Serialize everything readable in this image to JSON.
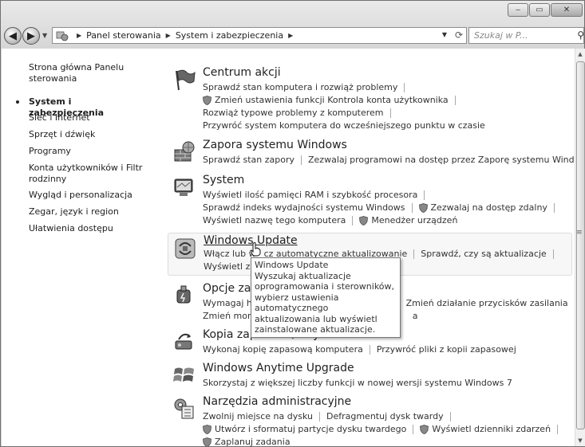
{
  "window": {
    "minimize": "‒",
    "maximize": "▭",
    "close": "✕"
  },
  "nav": {
    "back": "◀",
    "forward": "▶",
    "dropdown": "▼"
  },
  "address": {
    "crumbs": [
      "Panel sterowania",
      "System i zabezpieczenia"
    ],
    "separator": "▶",
    "dropdown": "▼",
    "refresh": "⟳"
  },
  "search": {
    "placeholder": "Szukaj w P...",
    "icon": "search-icon"
  },
  "sidebar": {
    "items": [
      {
        "label": "Strona główna Panelu sterowania"
      },
      {
        "label": "System i zabezpieczenia"
      },
      {
        "label": "Sieć i Internet"
      },
      {
        "label": "Sprzęt i dźwięk"
      },
      {
        "label": "Programy"
      },
      {
        "label": "Konta użytkowników i Filtr rodzinny"
      },
      {
        "label": "Wygląd i personalizacja"
      },
      {
        "label": "Zegar, język i region"
      },
      {
        "label": "Ułatwienia dostępu"
      }
    ]
  },
  "categories": [
    {
      "title": "Centrum akcji",
      "links": [
        [
          "Sprawdź stan komputera i rozwiąż problemy"
        ],
        [
          "Zmień ustawienia funkcji Kontrola konta użytkownika"
        ],
        [
          "Rozwiąż typowe problemy z komputerem"
        ],
        [
          "Przywróć system komputera do wcześniejszego punktu w czasie"
        ]
      ]
    },
    {
      "title": "Zapora systemu Windows",
      "links": [
        [
          "Sprawdź stan zapory",
          "Zezwalaj programowi na dostęp przez Zaporę systemu Windows"
        ]
      ]
    },
    {
      "title": "System",
      "links": [
        [
          "Wyświetl ilość pamięci RAM i szybkość procesora"
        ],
        [
          "Sprawdź indeks wydajności systemu Windows",
          "Zezwalaj na dostęp zdalny"
        ],
        [
          "Wyświetl nazwę tego komputera",
          "Menedżer urządzeń"
        ]
      ]
    },
    {
      "title": "Windows Update",
      "links": [
        [
          "Włącz lub w",
          "cz automatyczne aktualizowanie",
          "Sprawdź, czy są aktualizacje"
        ],
        [
          "Wyświetl zai"
        ]
      ]
    },
    {
      "title": "Opcje zas",
      "links": [
        [
          "Wymagaj ha",
          "Zmień działanie przycisków zasilania"
        ],
        [
          "Zmień mom",
          "a"
        ]
      ]
    },
    {
      "title": "Kopia zapasowa/Przywracanie",
      "links": [
        [
          "Wykonaj kopię zapasową komputera",
          "Przywróć pliki z kopii zapasowej"
        ]
      ]
    },
    {
      "title": "Windows Anytime Upgrade",
      "links": [
        [
          "Skorzystaj z większej liczby funkcji w nowej wersji systemu Windows 7"
        ]
      ]
    },
    {
      "title": "Narzędzia administracyjne",
      "links": [
        [
          "Zwolnij miejsce na dysku",
          "Defragmentuj dysk twardy"
        ],
        [
          "Utwórz i sformatuj partycje dysku twardego",
          "Wyświetl dzienniki zdarzeń"
        ],
        [
          "Zaplanuj zadania"
        ]
      ]
    }
  ],
  "tooltip": {
    "lines": [
      "Windows Update",
      "Wyszukaj aktualizacje",
      "oprogramowania i sterowników,",
      "wybierz ustawienia automatycznego",
      "aktualizowania lub wyświetl",
      "zainstalowane aktualizacje."
    ]
  },
  "scrollbar": {
    "up": "▲",
    "down": "▼",
    "grip": "≡"
  }
}
